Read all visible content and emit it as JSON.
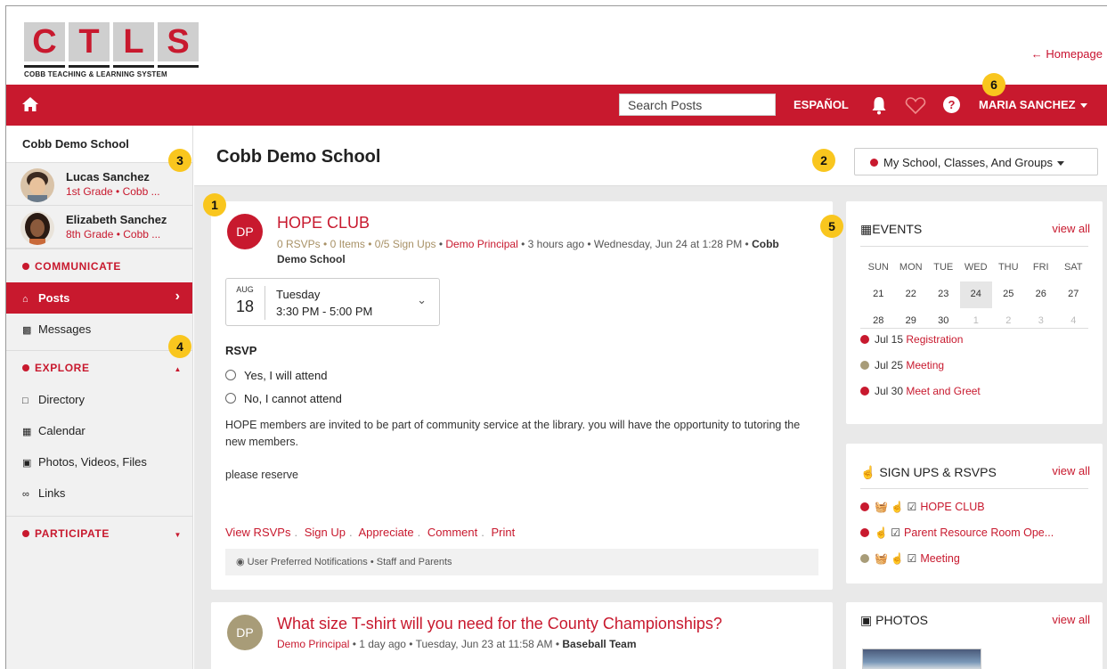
{
  "logo": {
    "letters": [
      "C",
      "T",
      "L",
      "S"
    ],
    "tagline": "COBB TEACHING & LEARNING SYSTEM"
  },
  "header": {
    "homepage_link": "Homepage"
  },
  "nav": {
    "home_icon": "home-icon",
    "search_placeholder": "Search Posts",
    "language": "ESPAÑOL",
    "user_name": "MARIA SANCHEZ"
  },
  "badges": [
    "1",
    "2",
    "3",
    "4",
    "5",
    "6"
  ],
  "sidebar": {
    "school": "Cobb Demo School",
    "students": [
      {
        "name": "Lucas Sanchez",
        "grade": "1st Grade • Cobb ..."
      },
      {
        "name": "Elizabeth Sanchez",
        "grade": "8th Grade • Cobb ..."
      }
    ],
    "communicate": {
      "label": "COMMUNICATE",
      "items": [
        {
          "label": "Posts",
          "active": true
        },
        {
          "label": "Messages",
          "active": false
        }
      ]
    },
    "explore": {
      "label": "EXPLORE",
      "items": [
        {
          "label": "Directory"
        },
        {
          "label": "Calendar"
        },
        {
          "label": "Photos, Videos, Files"
        },
        {
          "label": "Links"
        }
      ]
    },
    "participate": {
      "label": "PARTICIPATE"
    }
  },
  "main": {
    "title": "Cobb Demo School",
    "filter": "My School, Classes, And Groups"
  },
  "posts": [
    {
      "initials": "DP",
      "avatar_color": "#c8192e",
      "title": "HOPE CLUB",
      "rsvps": "0 RSVPs",
      "items": "0 Items",
      "signups": "0/5 Sign Ups",
      "author": "Demo Principal",
      "meta_tail": "3 hours ago • Wednesday, Jun 24 at 1:28 PM •",
      "group": "Cobb Demo School",
      "date_month": "AUG",
      "date_day": "18",
      "date_dow": "Tuesday",
      "date_time": "3:30 PM -  5:00 PM",
      "rsvp_heading": "RSVP",
      "rsvp_yes": "Yes, I will attend",
      "rsvp_no": "No, I cannot attend",
      "body": "HOPE members are invited to be part of community service at the library. you will have the opportunity to tutoring the new members.",
      "body2": "please reserve",
      "actions": [
        "View RSVPs",
        "Sign Up",
        "Appreciate",
        "Comment",
        "Print"
      ],
      "notice": "User Preferred Notifications • Staff and Parents"
    },
    {
      "initials": "DP",
      "avatar_color": "#a89c78",
      "title": "What size T-shirt will you need for the County Championships?",
      "author": "Demo Principal",
      "meta_tail": "• 1 day ago • Tuesday, Jun 23 at 11:58 AM •",
      "group": "Baseball Team"
    }
  ],
  "events": {
    "heading": "EVENTS",
    "view_all": "view all",
    "weekdays": [
      "SUN",
      "MON",
      "TUE",
      "WED",
      "THU",
      "FRI",
      "SAT"
    ],
    "week1": [
      "21",
      "22",
      "23",
      "24",
      "25",
      "26",
      "27"
    ],
    "week2": [
      "28",
      "29",
      "30",
      "1",
      "2",
      "3",
      "4"
    ],
    "today": "24",
    "list": [
      {
        "date": "Jul 15",
        "name": "Registration",
        "color": "#c8192e"
      },
      {
        "date": "Jul 25",
        "name": "Meeting",
        "color": "#a89c78"
      },
      {
        "date": "Jul 30",
        "name": "Meet and Greet",
        "color": "#c8192e"
      }
    ]
  },
  "signups": {
    "heading": "SIGN UPS & RSVPS",
    "view_all": "view all",
    "list": [
      {
        "name": "HOPE CLUB",
        "color": "#c8192e",
        "icons": "🧺 ☝ ☑"
      },
      {
        "name": "Parent Resource Room Ope...",
        "color": "#c8192e",
        "icons": "☝ ☑"
      },
      {
        "name": "Meeting",
        "color": "#a89c78",
        "icons": "🧺 ☝ ☑"
      }
    ]
  },
  "photos": {
    "heading": "PHOTOS",
    "view_all": "view all"
  }
}
